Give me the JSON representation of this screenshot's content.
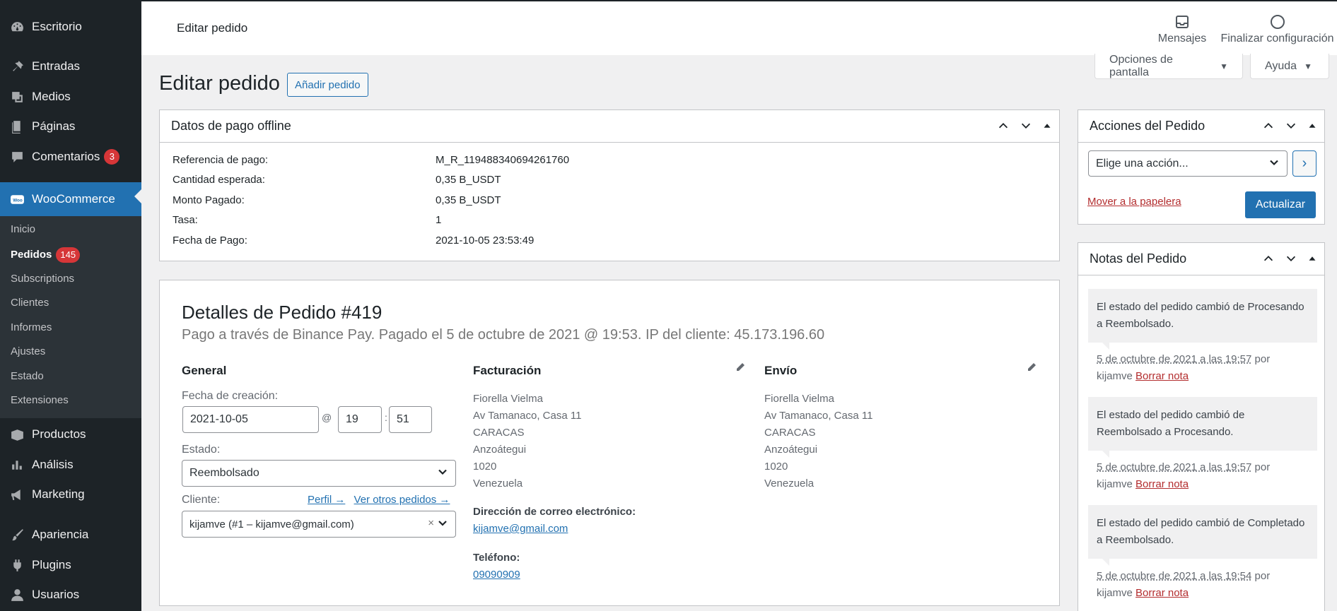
{
  "sidebar": {
    "items": [
      {
        "label": "Escritorio",
        "icon": "dashboard-icon"
      },
      {
        "label": "Entradas",
        "icon": "pin-icon"
      },
      {
        "label": "Medios",
        "icon": "media-icon"
      },
      {
        "label": "Páginas",
        "icon": "pages-icon"
      },
      {
        "label": "Comentarios",
        "icon": "comments-icon",
        "badge": "3"
      },
      {
        "label": "WooCommerce",
        "icon": "woo-icon"
      },
      {
        "label": "Productos",
        "icon": "products-icon"
      },
      {
        "label": "Análisis",
        "icon": "analytics-icon"
      },
      {
        "label": "Marketing",
        "icon": "megaphone-icon"
      },
      {
        "label": "Apariencia",
        "icon": "brush-icon"
      },
      {
        "label": "Plugins",
        "icon": "plugin-icon"
      },
      {
        "label": "Usuarios",
        "icon": "user-icon"
      }
    ],
    "submenu": [
      {
        "label": "Inicio"
      },
      {
        "label": "Pedidos",
        "badge": "145"
      },
      {
        "label": "Subscriptions"
      },
      {
        "label": "Clientes"
      },
      {
        "label": "Informes"
      },
      {
        "label": "Ajustes"
      },
      {
        "label": "Estado"
      },
      {
        "label": "Extensiones"
      }
    ]
  },
  "topbar": {
    "title": "Editar pedido",
    "messages": "Mensajes",
    "finish": "Finalizar configuración"
  },
  "screen_options": "Opciones de pantalla",
  "help": "Ayuda",
  "page": {
    "title": "Editar pedido",
    "add_button": "Añadir pedido"
  },
  "offline": {
    "title": "Datos de pago offline",
    "rows": [
      {
        "label": "Referencia de pago:",
        "value": "M_R_119488340694261760"
      },
      {
        "label": "Cantidad esperada:",
        "value": "0,35 B_USDT"
      },
      {
        "label": "Monto Pagado:",
        "value": "0,35 B_USDT"
      },
      {
        "label": "Tasa:",
        "value": "1"
      },
      {
        "label": "Fecha de Pago:",
        "value": "2021-10-05 23:53:49"
      }
    ]
  },
  "order": {
    "title": "Detalles de Pedido #419",
    "subtitle": "Pago a través de Binance Pay. Pagado el 5 de octubre de 2021 @ 19:53. IP del cliente: 45.173.196.60",
    "general": {
      "heading": "General",
      "date_label": "Fecha de creación:",
      "date": "2021-10-05",
      "at": "@",
      "hour": "19",
      "colon": ":",
      "minute": "51",
      "status_label": "Estado:",
      "status": "Reembolsado",
      "client_label": "Cliente:",
      "profile_link": "Perfil →",
      "other_orders_link": "Ver otros pedidos →",
      "client": "kijamve (#1 – kijamve@gmail.com)",
      "clear": "×"
    },
    "billing": {
      "heading": "Facturación",
      "lines": [
        "Fiorella Vielma",
        "Av Tamanaco, Casa 11",
        "CARACAS",
        "Anzoátegui",
        "1020",
        "Venezuela"
      ],
      "email_label": "Dirección de correo electrónico:",
      "email": "kijamve@gmail.com",
      "phone_label": "Teléfono:",
      "phone": "09090909"
    },
    "shipping": {
      "heading": "Envío",
      "lines": [
        "Fiorella Vielma",
        "Av Tamanaco, Casa 11",
        "CARACAS",
        "Anzoátegui",
        "1020",
        "Venezuela"
      ]
    }
  },
  "actions": {
    "title": "Acciones del Pedido",
    "select": "Elige una acción...",
    "go": "›",
    "trash": "Mover a la papelera",
    "update": "Actualizar"
  },
  "notes": {
    "title": "Notas del Pedido",
    "items": [
      {
        "text": "El estado del pedido cambió de Procesando a Reembolsado.",
        "time": "5 de octubre de 2021 a las 19:57",
        "by": "por",
        "author": "kijamve",
        "delete": "Borrar nota"
      },
      {
        "text": "El estado del pedido cambió de Reembolsado a Procesando.",
        "time": "5 de octubre de 2021 a las 19:57",
        "by": "por",
        "author": "kijamve",
        "delete": "Borrar nota"
      },
      {
        "text": "El estado del pedido cambió de Completado a Reembolsado.",
        "time": "5 de octubre de 2021 a las 19:54",
        "by": "por",
        "author": "kijamve",
        "delete": "Borrar nota"
      }
    ]
  },
  "colors": {
    "sidebar": "#1d2327",
    "accent": "#2271b1",
    "badge": "#d63638",
    "danger": "#b32d2e"
  }
}
